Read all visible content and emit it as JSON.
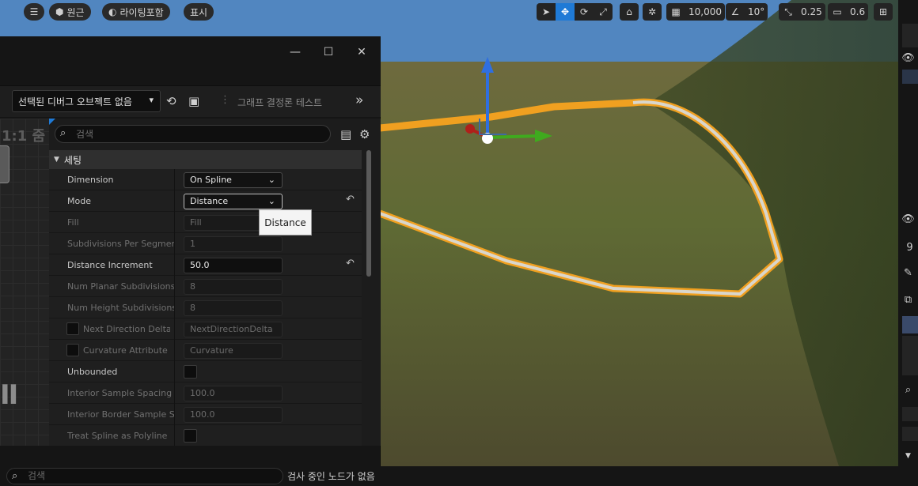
{
  "viewport_toolbar": {
    "menu_icon": "hamburger-icon",
    "perspective_label": "원근",
    "lighting_label": "라이팅포함",
    "show_label": "표시",
    "grid_snap_value": "10,000",
    "angle_snap_value": "10°",
    "scale_snap_value": "0.25",
    "camera_speed_value": "0.6"
  },
  "window": {
    "minimize_icon": "minimize-icon",
    "maximize_icon": "maximize-icon",
    "close_icon": "close-icon"
  },
  "debug_toolbar": {
    "debug_object_dropdown": "선택된 디버그 오브젝트 없음",
    "graph_test_label": "그래프 결정론 테스트"
  },
  "graph_panel": {
    "zoom_label": "1:1 줌"
  },
  "details": {
    "search_placeholder": "검색",
    "category_label": "세팅",
    "rows": [
      {
        "label": "Dimension",
        "value": "On Spline"
      },
      {
        "label": "Mode",
        "value": "Distance"
      },
      {
        "label": "Fill",
        "value": "Fill"
      },
      {
        "label": "Subdivisions Per Segment",
        "value": "1"
      },
      {
        "label": "Distance Increment",
        "value": "50.0"
      },
      {
        "label": "Num Planar Subdivisions",
        "value": "8"
      },
      {
        "label": "Num Height Subdivisions",
        "value": "8"
      },
      {
        "label": "Next Direction Delta...",
        "value": "NextDirectionDelta"
      },
      {
        "label": "Curvature Attribute",
        "value": "Curvature"
      },
      {
        "label": "Unbounded",
        "value": ""
      },
      {
        "label": "Interior Sample Spacing",
        "value": "100.0"
      },
      {
        "label": "Interior Border Sample S...",
        "value": "100.0"
      },
      {
        "label": "Treat Spline as Polyline",
        "value": ""
      }
    ],
    "tooltip": "Distance"
  },
  "bottom_bar": {
    "search_placeholder": "검색",
    "status_text": "검사 중인 노드가 없음"
  },
  "right_strip": {
    "value_text": "9"
  },
  "colors": {
    "accent": "#1f7ad6",
    "spline": "#f0a020"
  }
}
